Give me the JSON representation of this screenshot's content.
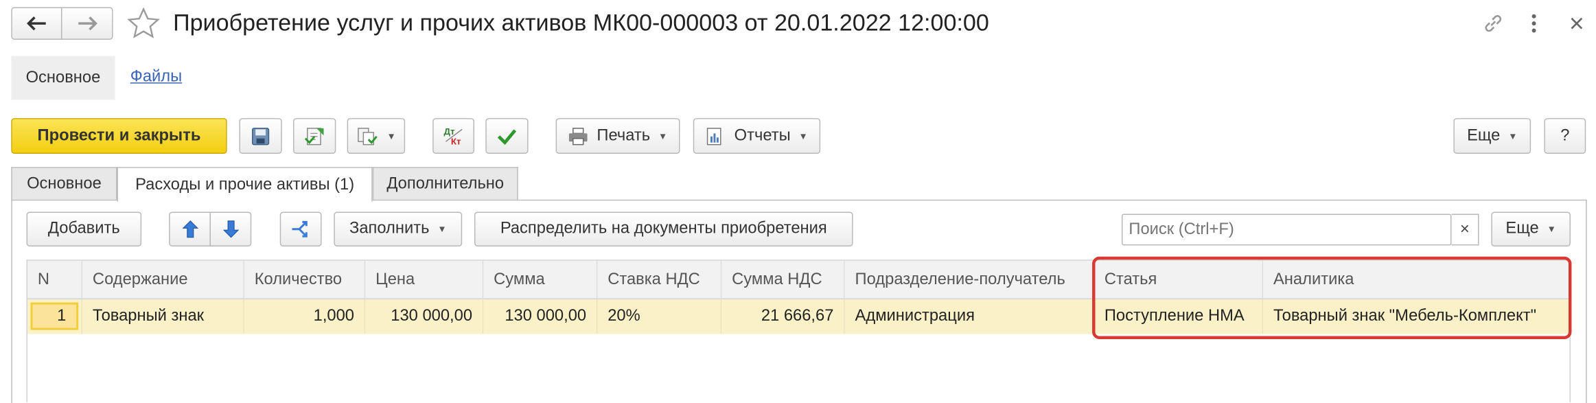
{
  "header": {
    "title": "Приобретение услуг и прочих активов МК00-000003 от 20.01.2022 12:00:00"
  },
  "nav": {
    "main_label": "Основное",
    "files_label": "Файлы"
  },
  "toolbar": {
    "post_and_close": "Провести и закрыть",
    "print_label": "Печать",
    "reports_label": "Отчеты",
    "more_label": "Еще",
    "help_label": "?"
  },
  "tabs": [
    {
      "label": "Основное"
    },
    {
      "label": "Расходы и прочие активы (1)"
    },
    {
      "label": "Дополнительно"
    }
  ],
  "table_toolbar": {
    "add_label": "Добавить",
    "fill_label": "Заполнить",
    "distribute_label": "Распределить на документы приобретения",
    "search_placeholder": "Поиск (Ctrl+F)",
    "clear_label": "×",
    "more_label": "Еще"
  },
  "table": {
    "columns": [
      "N",
      "Содержание",
      "Количество",
      "Цена",
      "Сумма",
      "Ставка НДС",
      "Сумма НДС",
      "Подразделение-получатель",
      "Статья",
      "Аналитика"
    ],
    "rows": [
      [
        "1",
        "Товарный знак",
        "1,000",
        "130 000,00",
        "130 000,00",
        "20%",
        "21 666,67",
        "Администрация",
        "Поступление НМА",
        "Товарный знак \"Мебель-Комплект\""
      ]
    ]
  },
  "colors": {
    "accent_yellow": "#f5d51c",
    "row_highlight": "#fbf1c9",
    "annotation_red": "#d83a33",
    "link_blue": "#3a64b6"
  }
}
